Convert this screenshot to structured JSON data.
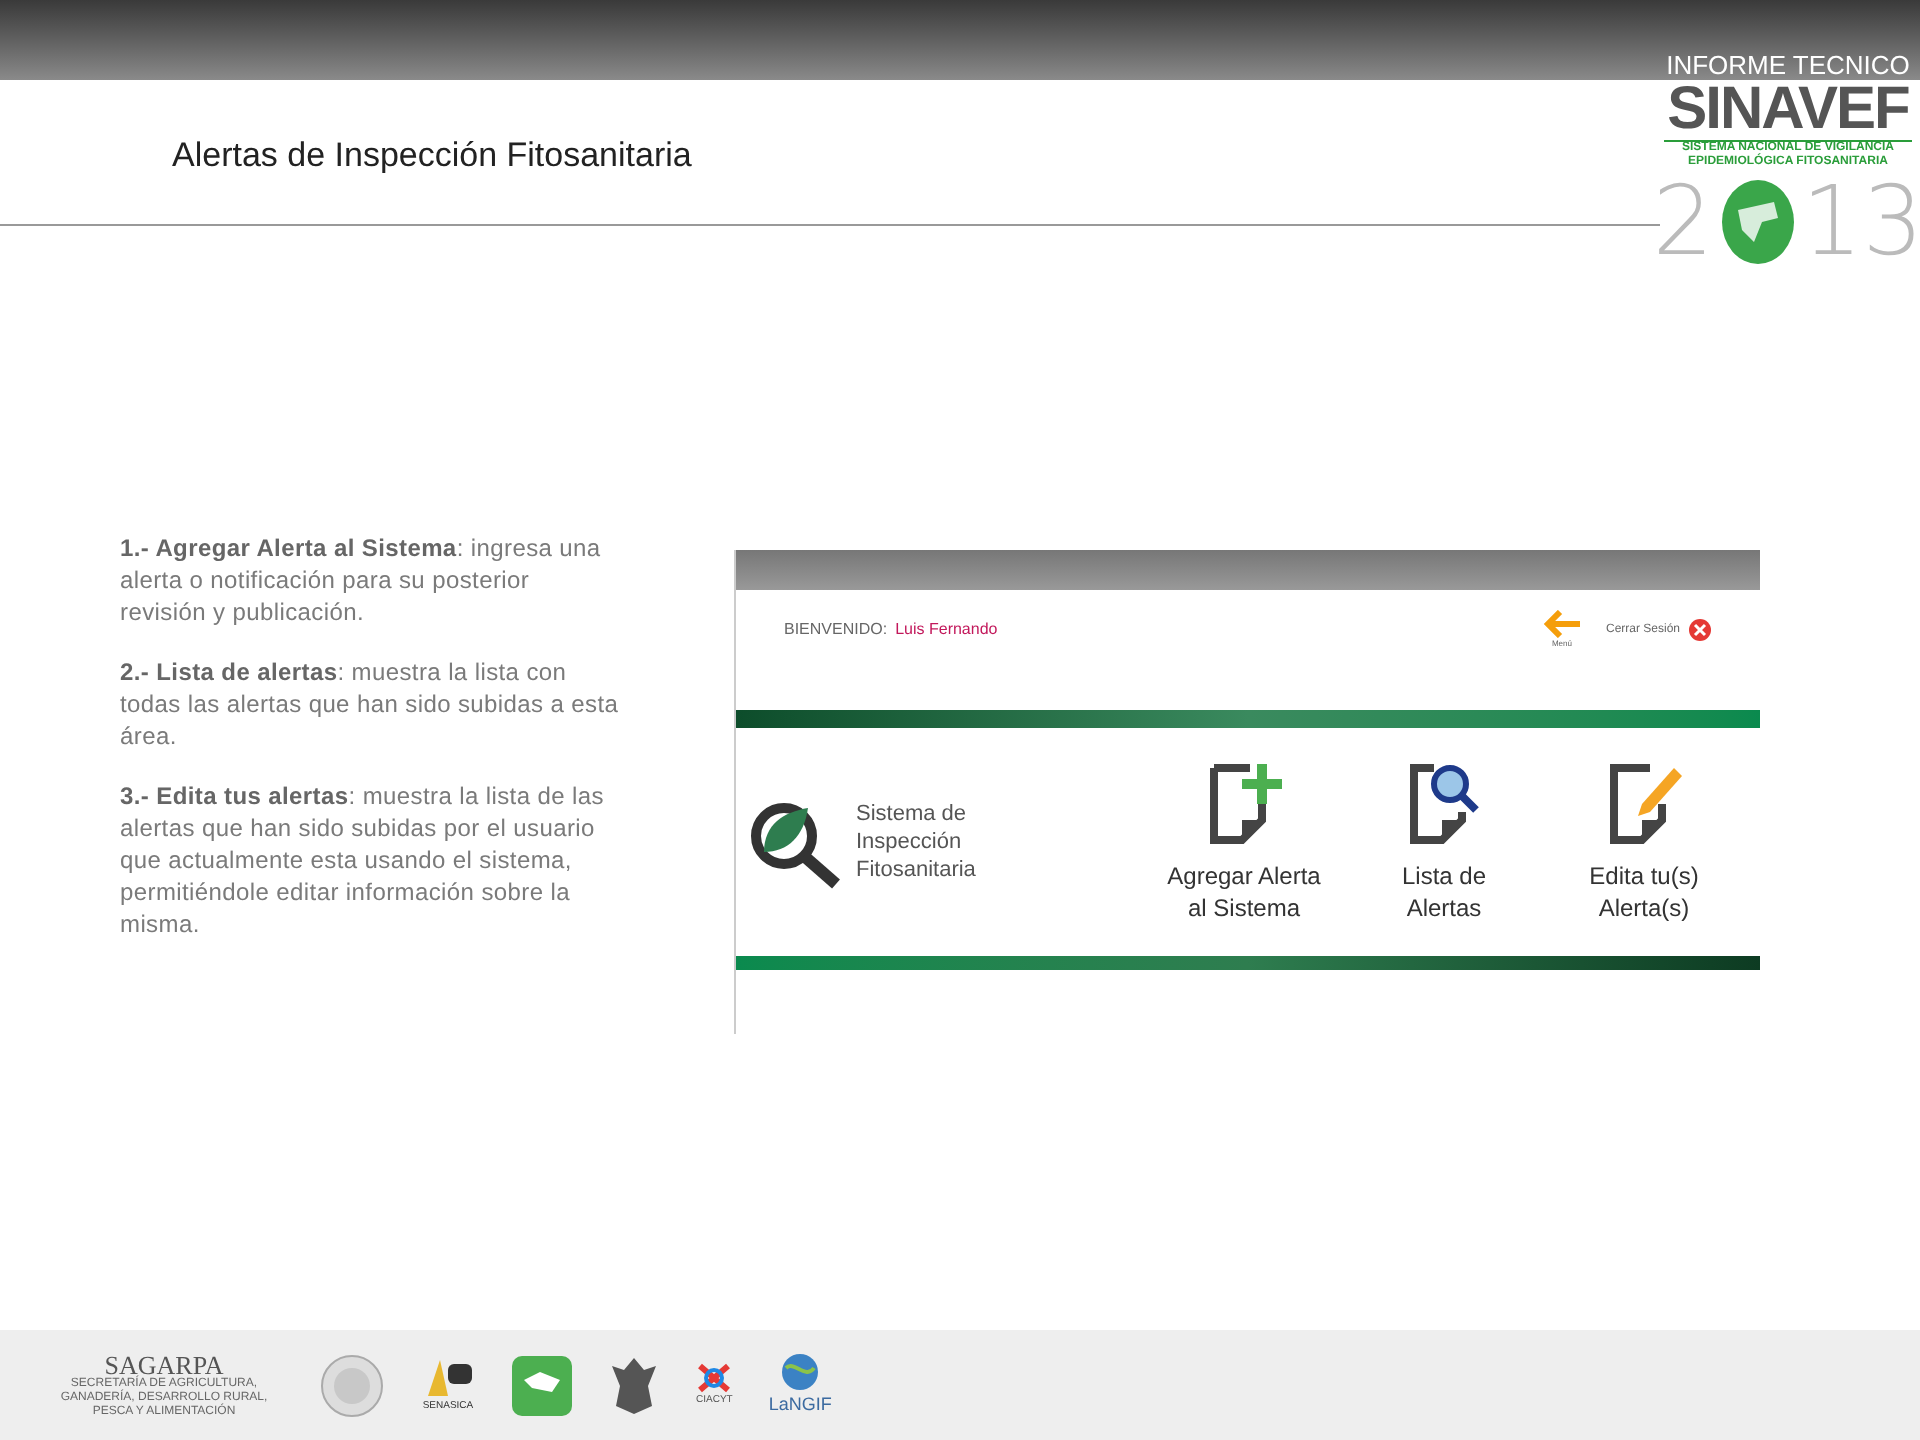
{
  "header": {
    "brand": {
      "kicker": "INFORME TECNICO",
      "name": "SINAVEF",
      "subtitle": "SISTEMA NACIONAL DE VIGILANCIA EPIDEMIOLÓGICA FITOSANITARIA",
      "year_start": "2",
      "year_end": "13"
    }
  },
  "title": "Alertas de Inspección Fitosanitaria",
  "descriptions": [
    {
      "term": "1.- Agregar Alerta al Sistema",
      "text": ": ingresa una alerta o notificación para su posterior revisión y publicación."
    },
    {
      "term": "2.- Lista de alertas",
      "text": ": muestra la lista con todas las alertas que han sido subidas a esta área."
    },
    {
      "term": "3.- Edita tus alertas",
      "text": ": muestra la lista de las alertas que han sido subidas por el usuario que actualmente esta usando el sistema, permitiéndole editar información sobre la misma."
    }
  ],
  "app_screenshot": {
    "welcome_label": "BIENVENIDO:",
    "user_name": "Luis Fernando",
    "menu_label": "Menú",
    "logout_label": "Cerrar Sesión",
    "app_name": [
      "Sistema de",
      "Inspección",
      "Fitosanitaria"
    ],
    "actions": [
      {
        "kind": "add",
        "label": [
          "Agregar Alerta",
          "al Sistema"
        ]
      },
      {
        "kind": "search",
        "label": [
          "Lista de",
          "Alertas"
        ]
      },
      {
        "kind": "edit",
        "label": [
          "Edita tu(s)",
          "Alerta(s)"
        ]
      }
    ]
  },
  "footer": {
    "sagarpa": "SAGARPA",
    "sagarpa_subtitle": "SECRETARÍA DE AGRICULTURA, GANADERÍA, DESARROLLO RURAL, PESCA Y ALIMENTACIÓN",
    "senasica": "SENASICA",
    "ciacyt": "CIACYT",
    "langif": "LaNGIF"
  }
}
